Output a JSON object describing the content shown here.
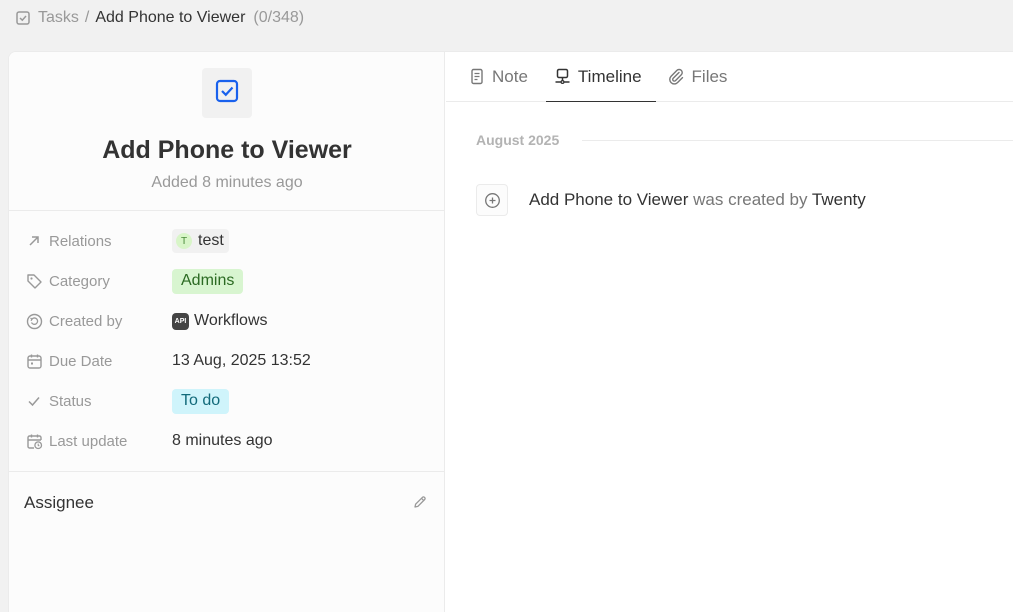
{
  "breadcrumb": {
    "icon": "checkbox-icon",
    "parent": "Tasks",
    "separator": "/",
    "current": "Add Phone to Viewer",
    "count": "(0/348)"
  },
  "record": {
    "icon": "checkbox-icon",
    "title": "Add Phone to Viewer",
    "subtitle": "Added 8 minutes ago"
  },
  "fields": [
    {
      "icon": "arrow-up-right-icon",
      "label": "Relations",
      "value": "test",
      "avatar_letter": "T"
    },
    {
      "icon": "tag-icon",
      "label": "Category",
      "value": "Admins"
    },
    {
      "icon": "created-by-icon",
      "label": "Created by",
      "value": "Workflows",
      "badge": "API"
    },
    {
      "icon": "calendar-icon",
      "label": "Due Date",
      "value": "13 Aug, 2025 13:52"
    },
    {
      "icon": "check-icon",
      "label": "Status",
      "value": "To do"
    },
    {
      "icon": "calendar-clock-icon",
      "label": "Last update",
      "value": "8 minutes ago"
    }
  ],
  "assignee": {
    "title": "Assignee",
    "edit_icon": "pencil-icon"
  },
  "tabs": [
    {
      "icon": "note-icon",
      "label": "Note",
      "active": false
    },
    {
      "icon": "timeline-icon",
      "label": "Timeline",
      "active": true
    },
    {
      "icon": "paperclip-icon",
      "label": "Files",
      "active": false
    }
  ],
  "timeline": {
    "month": "August 2025",
    "event": {
      "icon": "plus-circle-icon",
      "subject": "Add Phone to Viewer",
      "verb": "was created by",
      "actor": "Twenty"
    }
  },
  "colors": {
    "accent_blue": "#1961ed",
    "category_tag_bg": "#d8f5d0",
    "status_tag_bg": "#cff4fb"
  }
}
